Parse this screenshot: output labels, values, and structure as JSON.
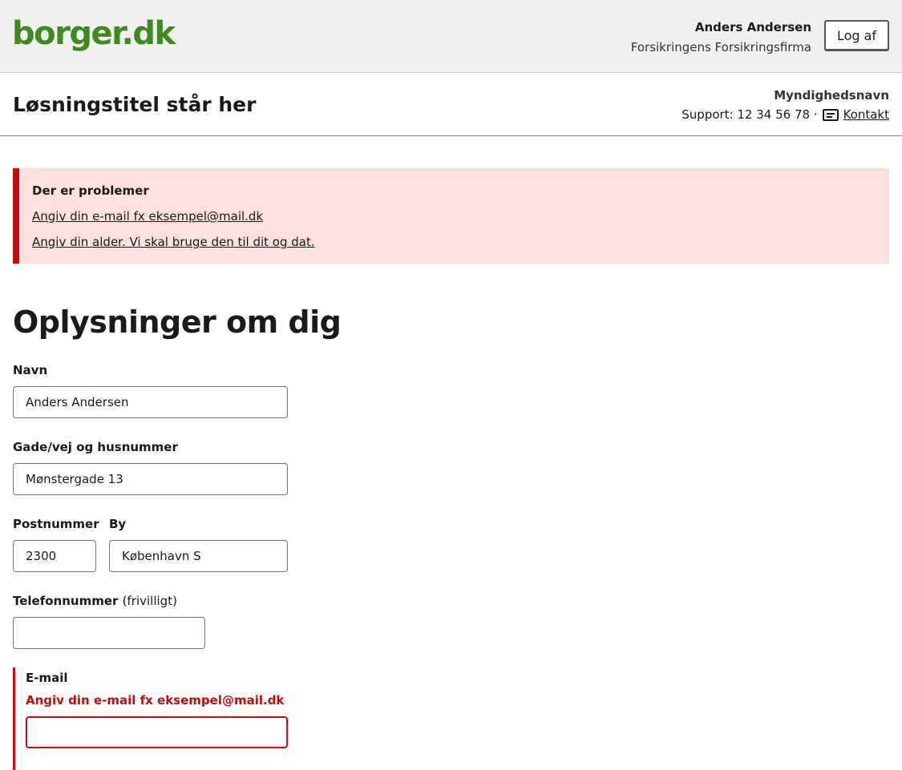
{
  "header": {
    "logo_text": "borger.dk",
    "user_name": "Anders Andersen",
    "user_org": "Forsikringens Forsikringsfirma",
    "logout_label": "Log af"
  },
  "subheader": {
    "solution_title": "Løsningstitel står her",
    "authority_name": "Myndighedsnavn",
    "support_text": "Support: 12 34 56 78 ·",
    "contact_label": "Kontakt",
    "contact_icon": "message-icon"
  },
  "error_summary": {
    "title": "Der er problemer",
    "errors": [
      "Angiv din e-mail fx eksempel@mail.dk",
      "Angiv din alder. Vi skal bruge den til dit og dat."
    ]
  },
  "form": {
    "heading": "Oplysninger om dig",
    "fields": {
      "name": {
        "label": "Navn",
        "value": "Anders Andersen"
      },
      "street": {
        "label": "Gade/vej og husnummer",
        "value": "Mønstergade 13"
      },
      "postcode": {
        "label": "Postnummer",
        "value": "2300"
      },
      "city": {
        "label": "By",
        "value": "København S"
      },
      "phone": {
        "label": "Telefonnummer",
        "optional": "(frivilligt)",
        "value": ""
      },
      "email": {
        "label": "E-mail",
        "error": "Angiv din e-mail fx eksempel@mail.dk",
        "value": ""
      }
    }
  },
  "colors": {
    "brand_green": "#3e8a1f",
    "error_red": "#c50c0c",
    "error_bg": "#fddfe0",
    "header_bg": "#f0f0f0"
  }
}
